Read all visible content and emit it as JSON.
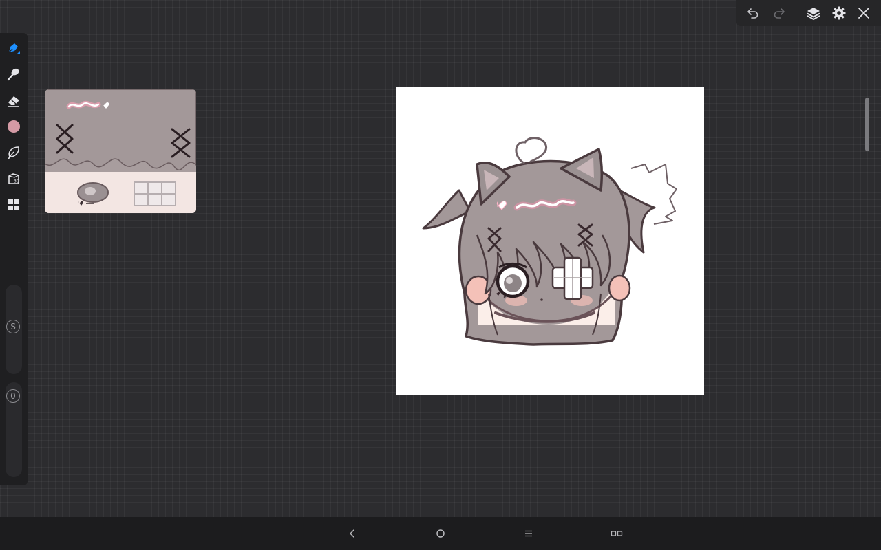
{
  "toolbar": {
    "undo_icon": "undo-icon",
    "redo_icon": "redo-icon",
    "layers_icon": "layers-icon",
    "settings_icon": "gear-icon",
    "close_icon": "close-icon"
  },
  "tools": [
    {
      "name": "pen-tool",
      "icon": "pen-icon",
      "active": true
    },
    {
      "name": "smudge-tool",
      "icon": "smudge-icon"
    },
    {
      "name": "eraser-tool",
      "icon": "eraser-icon"
    },
    {
      "name": "color-tool",
      "icon": "color-swatch-icon",
      "color": "#d49aa5"
    },
    {
      "name": "lasso-tool",
      "icon": "lasso-icon"
    },
    {
      "name": "3d-tool",
      "icon": "3d-icon",
      "label": "3D"
    },
    {
      "name": "gallery-tool",
      "icon": "grid-icon"
    }
  ],
  "sliders": {
    "size_label": "S",
    "opacity_label": "0"
  },
  "colors": {
    "accent": "#1e90ff",
    "canvas": "#ffffff",
    "workspace": "#2c2c2f",
    "hair": "#a09697",
    "outline": "#4a3a3e",
    "blush": "#f4c1b8"
  }
}
